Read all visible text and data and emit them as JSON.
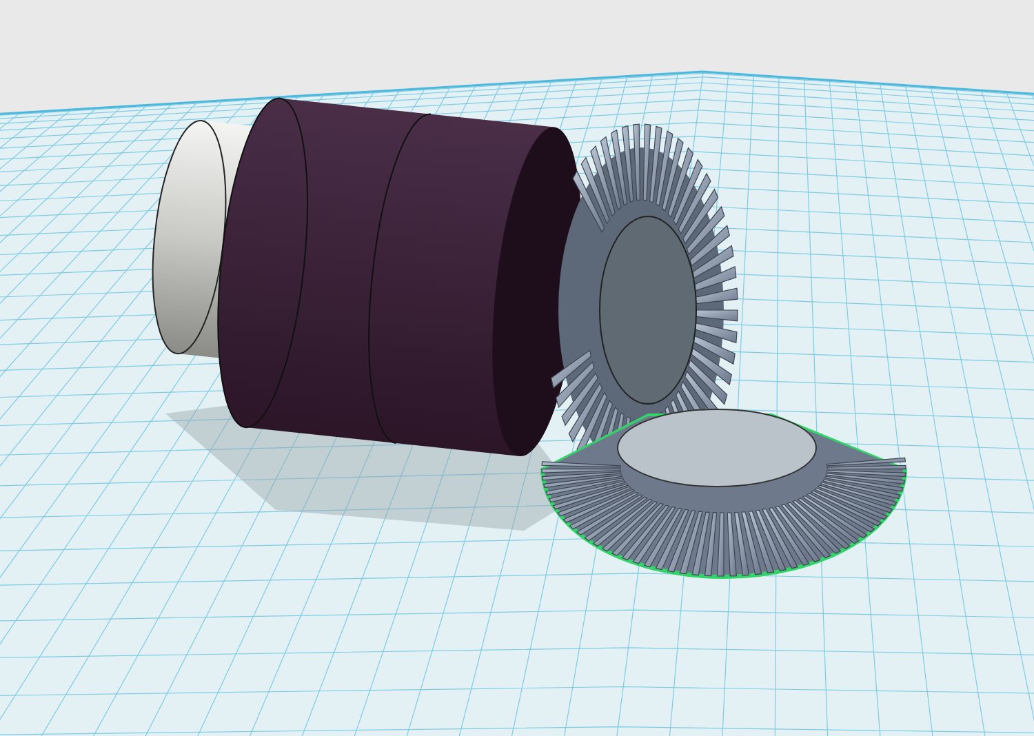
{
  "gears": [
    {
      "selected": false
    },
    {
      "selected": true
    }
  ]
}
